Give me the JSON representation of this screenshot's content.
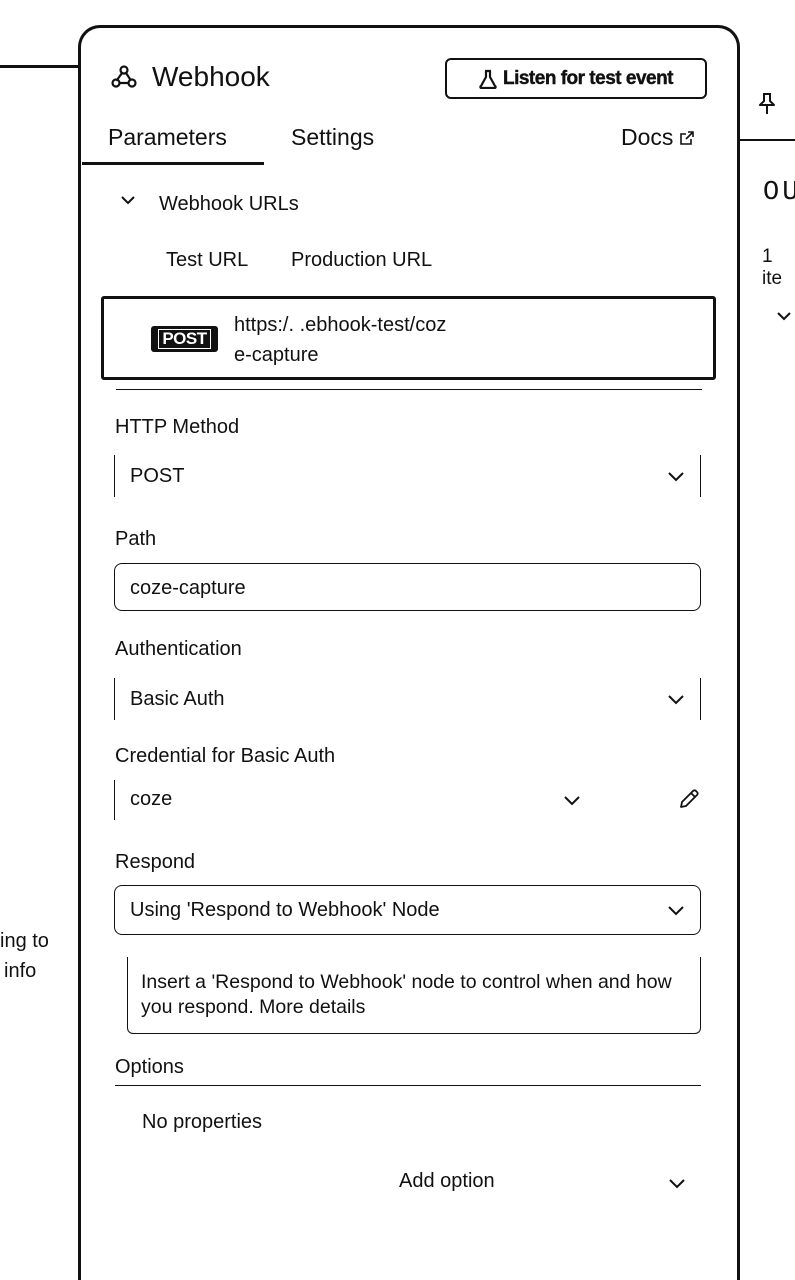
{
  "node": {
    "title": "Webhook",
    "listen_button": "Listen for test event"
  },
  "tabs": {
    "parameters": "Parameters",
    "settings": "Settings",
    "docs": "Docs"
  },
  "webhook_urls": {
    "section_title": "Webhook URLs",
    "tab_test": "Test URL",
    "tab_production": "Production URL",
    "method_badge": "POST",
    "url_line1": "https:/.                     .ebhook-test/coz",
    "url_line2": "e-capture"
  },
  "fields": {
    "http_method": {
      "label": "HTTP Method",
      "value": "POST"
    },
    "path": {
      "label": "Path",
      "value": "coze-capture"
    },
    "authentication": {
      "label": "Authentication",
      "value": "Basic Auth"
    },
    "credential": {
      "label": "Credential for Basic Auth",
      "value": "coze"
    },
    "respond": {
      "label": "Respond",
      "value": "Using 'Respond to Webhook' Node"
    }
  },
  "notice": {
    "text": "Insert a 'Respond to Webhook' node to control when and how you respond. More details"
  },
  "options": {
    "label": "Options",
    "empty_text": "No properties",
    "add_option": "Add option"
  },
  "right_panel": {
    "heading_fragment": "OU",
    "items_fragment": "1 ite"
  },
  "left_canvas": {
    "line1": "ing to",
    "line2": "info"
  }
}
